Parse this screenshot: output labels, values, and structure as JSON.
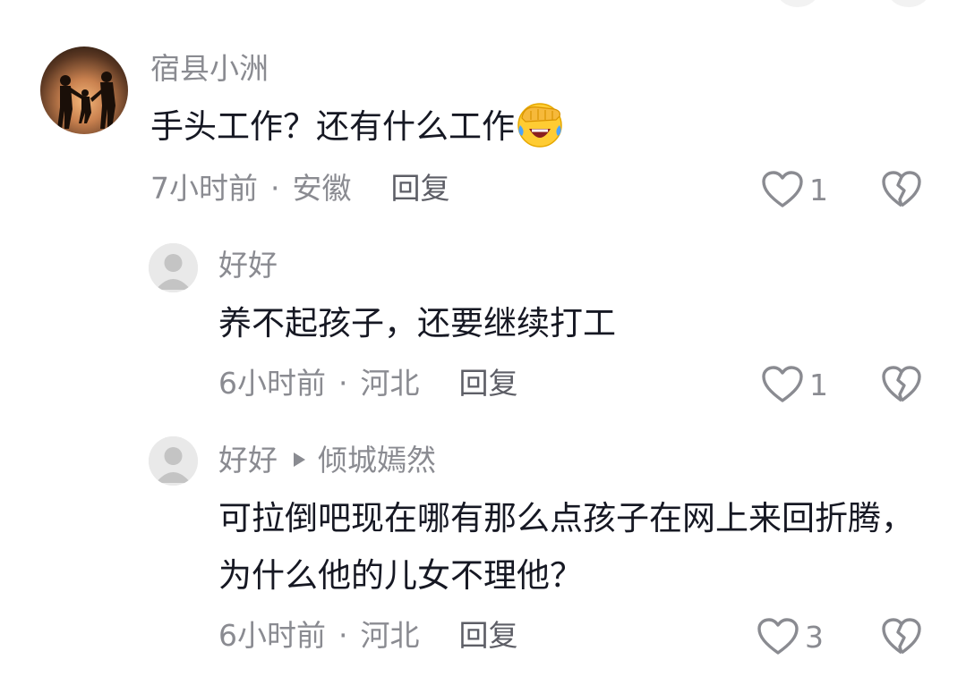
{
  "comments": [
    {
      "username": "宿县小洲",
      "text": "手头工作？还有什么工作",
      "emoji": "face-palm-laugh-icon",
      "time": "7小时前",
      "location": "安徽",
      "reply_label": "回复",
      "likes": "1"
    },
    {
      "username": "好好",
      "text": "养不起孩子，还要继续打工",
      "time": "6小时前",
      "location": "河北",
      "reply_label": "回复",
      "likes": "1"
    },
    {
      "username": "好好",
      "reply_to": "倾城嫣然",
      "text": "可拉倒吧现在哪有那么点孩子在网上来回折腾，为什么他的儿女不理他？",
      "time": "6小时前",
      "location": "河北",
      "reply_label": "回复",
      "likes": "3"
    }
  ],
  "colors": {
    "primary_text": "#161823",
    "secondary_text": "#8a8b91",
    "reply_button": "#5d5e66",
    "icon_stroke": "#8a8b91",
    "placeholder_avatar": "#d6d6d6"
  },
  "icons": {
    "like": "heart-outline-icon",
    "dislike": "broken-heart-outline-icon",
    "reply_arrow": "triangle-right-icon"
  }
}
